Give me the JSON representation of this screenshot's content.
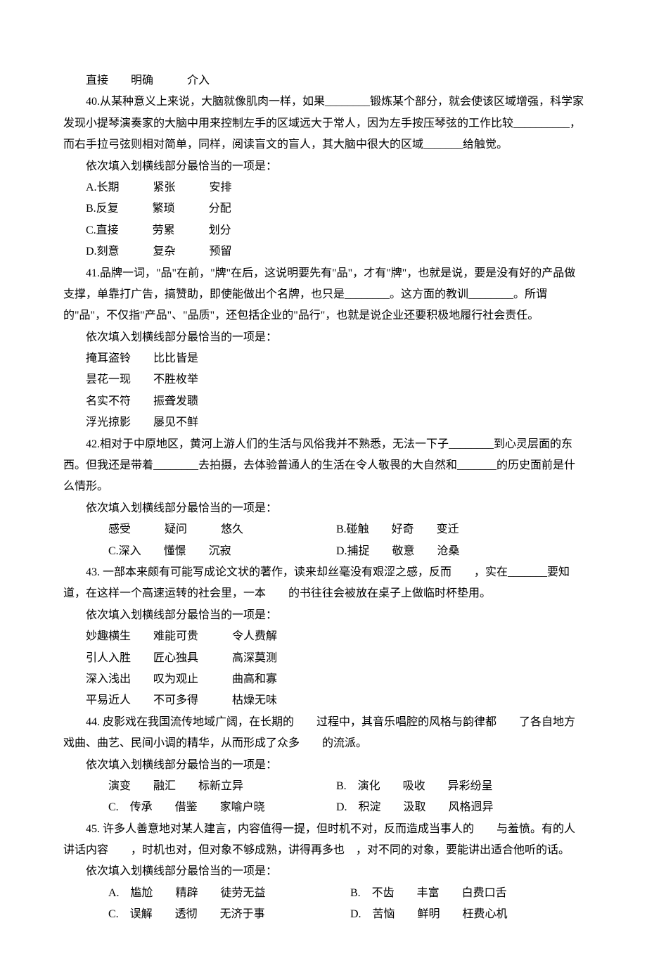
{
  "q39_tail": "直接　　明确　　　介入",
  "q40": {
    "text": "40.从某种意义上来说，大脑就像肌肉一样，如果________锻炼某个部分，就会使该区域增强，科学家发现小提琴演奏家的大脑中用来控制左手的区域远大于常人，因为左手按压琴弦的工作比较__________，而右手拉弓弦则相对简单，同样，阅读盲文的盲人，其大脑中很大的区域_______给触觉。",
    "prompt": "依次填入划横线部分最恰当的一项是：",
    "opts": {
      "A": "A.长期　　　紧张　　　安排",
      "B": "B.反复　　　繁琐　　　分配",
      "C": "C.直接　　　劳累　　　划分",
      "D": "D.刻意　　　复杂　　　预留"
    }
  },
  "q41": {
    "text": "41.品牌一词，\"品\"在前，\"牌\"在后，这说明要先有\"品\"，才有\"牌\"，也就是说，要是没有好的产品做支撑，单靠打广告，搞赞助，即使能做出个名牌，也只是________。这方面的教训________。所谓的\"品\"，不仅指\"产品\"、\"品质\"，还包括企业的\"品行\"，也就是说企业还要积极地履行社会责任。",
    "prompt": "依次填入划横线部分最恰当的一项是：",
    "opts": {
      "A": "掩耳盗铃　　比比皆是",
      "B": "昙花一现　　不胜枚举",
      "C": "名实不符　　振聋发聩",
      "D": "浮光掠影　　屡见不鲜"
    }
  },
  "q42": {
    "text": "42.相对于中原地区，黄河上游人们的生活与风俗我并不熟悉，无法一下子________到心灵层面的东西。但我还是带着________去拍摄，去体验普通人的生活在令人敬畏的大自然和_______的历史面前是什么情形。",
    "prompt": "依次填入划横线部分最恰当的一项是：",
    "row1_left": "感受　　　疑问　　　悠久",
    "row1_right": "B.碰触　　好奇　　变迁",
    "row2_left": "C.深入　　懂憬　　沉寂",
    "row2_right": "D.捕捉　　敬意　　沧桑"
  },
  "q43": {
    "text": "43. 一部本来颇有可能写成论文状的著作，读来却丝毫没有艰涩之感，反而　　，实在_______要知道，在这样一个高速运转的社会里，一本　　的书往往会被放在桌子上做临时杯垫用。",
    "prompt": "依次填入划横线部分最恰当的一项是：",
    "opts": {
      "A": "妙趣横生　　难能可贵　　　令人费解",
      "B": "引人入胜　　匠心独具　　　高深莫测",
      "C": "深入浅出　　叹为观止　　　曲高和寡",
      "D": "平易近人　　不可多得　　　枯燥无味"
    }
  },
  "q44": {
    "text": "44. 皮影戏在我国流传地域广阔，在长期的　　过程中，其音乐唱腔的风格与韵律都　　了各自地方戏曲、曲艺、民间小调的精华，从而形成了众多　　的流派。",
    "prompt": "依次填入划横线部分最恰当的一项是：",
    "row1_left": "演变　　融汇　　标新立异",
    "row1_right": "B.　演化　　吸收　　异彩纷呈",
    "row2_left": "C.　传承　　借鉴　　家喻户晓",
    "row2_right": "D.　积淀　　汲取　　风格迥异"
  },
  "q45": {
    "text": "45. 许多人善意地对某人建言，内容值得一提，但时机不对，反而造成当事人的　　与羞愤。有的人讲话内容　　，时机也对，但对象不够成熟，讲得再多也　，对不同的对象，要能讲出适合他听的话。",
    "prompt": "依次填入划横线部分最恰当的一项是：",
    "row1_left": "A.　尴尬　　精辟　　徒劳无益",
    "row1_right": "B.　不齿　　丰富　　白费口舌",
    "row2_left": "C.　误解　　透彻　　无济于事",
    "row2_right": "D.　苦恼　　鲜明　　枉费心机"
  }
}
